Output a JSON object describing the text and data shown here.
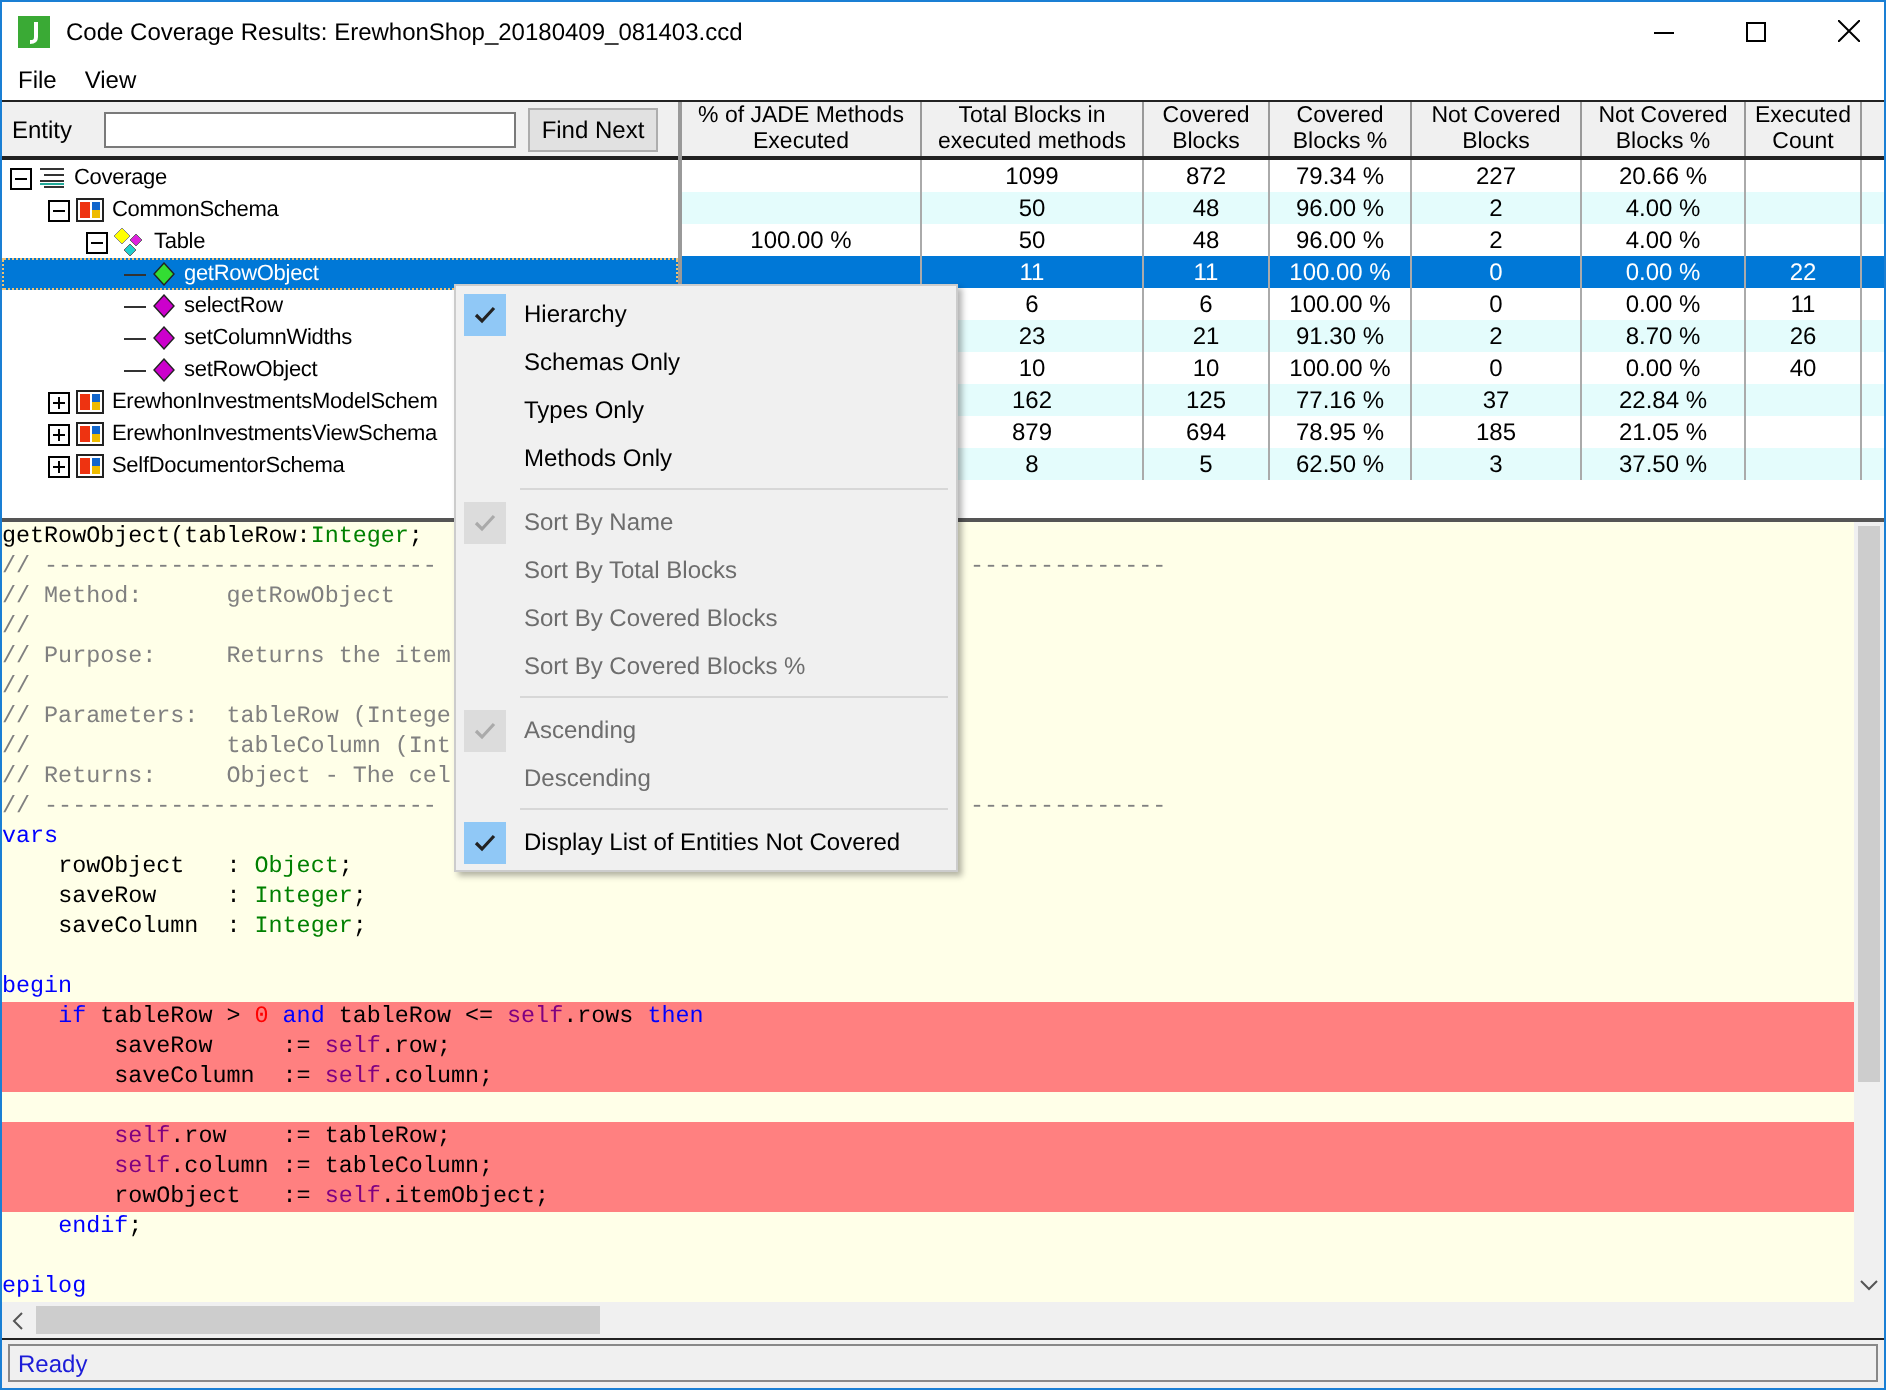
{
  "window": {
    "title": "Code Coverage Results: ErewhonShop_20180409_081403.ccd"
  },
  "menu_bar": [
    {
      "label": "File"
    },
    {
      "label": "View"
    }
  ],
  "entity_search": {
    "label": "Entity",
    "button": "Find Next"
  },
  "grid": {
    "columns": [
      "% of JADE Methods Executed",
      "Total Blocks in executed methods",
      "Covered Blocks",
      "Covered Blocks %",
      "Not Covered Blocks",
      "Not Covered Blocks %",
      "Executed Count"
    ]
  },
  "tree": [
    {
      "label": "Coverage",
      "kind": "root",
      "expanded": true,
      "selected": false,
      "cells": [
        null,
        "1099",
        "872",
        "79.34 %",
        "227",
        "20.66 %",
        null
      ],
      "children": [
        {
          "label": "CommonSchema",
          "kind": "schema",
          "expanded": true,
          "selected": false,
          "cells": [
            null,
            "50",
            "48",
            "96.00 %",
            "2",
            "4.00 %",
            null
          ],
          "children": [
            {
              "label": "Table",
              "kind": "type",
              "expanded": true,
              "selected": false,
              "cells": [
                "100.00 %",
                "50",
                "48",
                "96.00 %",
                "2",
                "4.00 %",
                null
              ],
              "children": [
                {
                  "label": "getRowObject",
                  "kind": "method",
                  "color": "#33dd33",
                  "selected": true,
                  "cells": [
                    null,
                    "11",
                    "11",
                    "100.00 %",
                    "0",
                    "0.00 %",
                    "22"
                  ]
                },
                {
                  "label": "selectRow",
                  "kind": "method",
                  "color": "#cc00cc",
                  "selected": false,
                  "cells": [
                    null,
                    "6",
                    "6",
                    "100.00 %",
                    "0",
                    "0.00 %",
                    "11"
                  ]
                },
                {
                  "label": "setColumnWidths",
                  "kind": "method",
                  "color": "#cc00cc",
                  "selected": false,
                  "cells": [
                    null,
                    "23",
                    "21",
                    "91.30 %",
                    "2",
                    "8.70 %",
                    "26"
                  ]
                },
                {
                  "label": "setRowObject",
                  "kind": "method",
                  "color": "#cc00cc",
                  "selected": false,
                  "cells": [
                    null,
                    "10",
                    "10",
                    "100.00 %",
                    "0",
                    "0.00 %",
                    "40"
                  ]
                }
              ]
            }
          ]
        },
        {
          "label": "ErewhonInvestmentsModelSchem",
          "kind": "schema",
          "expanded": false,
          "selected": false,
          "cells": [
            null,
            "162",
            "125",
            "77.16 %",
            "37",
            "22.84 %",
            null
          ]
        },
        {
          "label": "ErewhonInvestmentsViewSchema",
          "kind": "schema",
          "expanded": false,
          "selected": false,
          "cells": [
            null,
            "879",
            "694",
            "78.95 %",
            "185",
            "21.05 %",
            null
          ]
        },
        {
          "label": "SelfDocumentorSchema",
          "kind": "schema",
          "expanded": false,
          "selected": false,
          "cells": [
            null,
            "8",
            "5",
            "62.50 %",
            "3",
            "37.50 %",
            null
          ]
        }
      ]
    }
  ],
  "code": [
    {
      "uncovered": false,
      "segments": [
        {
          "t": "getRowObject(tableRow:",
          "kind": "plain"
        },
        {
          "t": "Integer",
          "kind": "type"
        },
        {
          "t": ";",
          "kind": "plain"
        }
      ]
    },
    {
      "uncovered": false,
      "segments": [
        {
          "t": "// ----------------------------",
          "kind": "comment"
        },
        {
          "t": "                                      --------------",
          "kind": "comment"
        }
      ]
    },
    {
      "uncovered": false,
      "segments": [
        {
          "t": "// Method:      getRowObject",
          "kind": "comment"
        }
      ]
    },
    {
      "uncovered": false,
      "segments": [
        {
          "t": "//",
          "kind": "comment"
        }
      ]
    },
    {
      "uncovered": false,
      "segments": [
        {
          "t": "// Purpose:     Returns the item",
          "kind": "comment"
        }
      ]
    },
    {
      "uncovered": false,
      "segments": [
        {
          "t": "//",
          "kind": "comment"
        }
      ]
    },
    {
      "uncovered": false,
      "segments": [
        {
          "t": "// Parameters:  tableRow (Intege",
          "kind": "comment"
        }
      ]
    },
    {
      "uncovered": false,
      "segments": [
        {
          "t": "//              tableColumn (Int",
          "kind": "comment"
        }
      ]
    },
    {
      "uncovered": false,
      "segments": [
        {
          "t": "// Returns:     Object - The cel",
          "kind": "comment"
        }
      ]
    },
    {
      "uncovered": false,
      "segments": [
        {
          "t": "// ----------------------------",
          "kind": "comment"
        },
        {
          "t": "                                      --------------",
          "kind": "comment"
        }
      ]
    },
    {
      "uncovered": false,
      "segments": [
        {
          "t": "vars",
          "kind": "keyword"
        }
      ]
    },
    {
      "uncovered": false,
      "segments": [
        {
          "t": "    rowObject   : ",
          "kind": "plain"
        },
        {
          "t": "Object",
          "kind": "type"
        },
        {
          "t": ";",
          "kind": "plain"
        }
      ]
    },
    {
      "uncovered": false,
      "segments": [
        {
          "t": "    saveRow     : ",
          "kind": "plain"
        },
        {
          "t": "Integer",
          "kind": "type"
        },
        {
          "t": ";",
          "kind": "plain"
        }
      ]
    },
    {
      "uncovered": false,
      "segments": [
        {
          "t": "    saveColumn  : ",
          "kind": "plain"
        },
        {
          "t": "Integer",
          "kind": "type"
        },
        {
          "t": ";",
          "kind": "plain"
        }
      ]
    },
    {
      "uncovered": false
    },
    {
      "uncovered": false,
      "segments": [
        {
          "t": "begin",
          "kind": "keyword"
        }
      ]
    },
    {
      "uncovered": true,
      "segments": [
        {
          "t": "    if",
          "kind": "keyword"
        },
        {
          "t": " tableRow > ",
          "kind": "plain"
        },
        {
          "t": "0",
          "kind": "number"
        },
        {
          "t": " and",
          "kind": "keyword"
        },
        {
          "t": " tableRow <= ",
          "kind": "plain"
        },
        {
          "t": "self",
          "kind": "self"
        },
        {
          "t": ".rows ",
          "kind": "plain"
        },
        {
          "t": "then",
          "kind": "keyword"
        }
      ]
    },
    {
      "uncovered": true,
      "segments": [
        {
          "t": "        saveRow     := ",
          "kind": "plain"
        },
        {
          "t": "self",
          "kind": "self"
        },
        {
          "t": ".row;",
          "kind": "plain"
        }
      ]
    },
    {
      "uncovered": true,
      "segments": [
        {
          "t": "        saveColumn  := ",
          "kind": "plain"
        },
        {
          "t": "self",
          "kind": "self"
        },
        {
          "t": ".column;",
          "kind": "plain"
        }
      ]
    },
    {
      "uncovered": false
    },
    {
      "uncovered": true,
      "segments": [
        {
          "t": "        self",
          "kind": "self"
        },
        {
          "t": ".row    := tableRow;",
          "kind": "plain"
        }
      ]
    },
    {
      "uncovered": true,
      "segments": [
        {
          "t": "        self",
          "kind": "self"
        },
        {
          "t": ".column := tableColumn;",
          "kind": "plain"
        }
      ]
    },
    {
      "uncovered": true,
      "segments": [
        {
          "t": "        rowObject   := ",
          "kind": "plain"
        },
        {
          "t": "self",
          "kind": "self"
        },
        {
          "t": ".itemObject;",
          "kind": "plain"
        }
      ]
    },
    {
      "uncovered": false,
      "segments": [
        {
          "t": "    endif",
          "kind": "keyword"
        },
        {
          "t": ";",
          "kind": "plain"
        }
      ]
    },
    {
      "uncovered": false
    },
    {
      "uncovered": false,
      "segments": [
        {
          "t": "epilog",
          "kind": "keyword"
        }
      ]
    }
  ],
  "context_menu": [
    {
      "kind": "item",
      "label": "Hierarchy",
      "checked": true,
      "disabled": false
    },
    {
      "kind": "item",
      "label": "Schemas Only",
      "checked": false,
      "disabled": false
    },
    {
      "kind": "item",
      "label": "Types Only",
      "checked": false,
      "disabled": false
    },
    {
      "kind": "item",
      "label": "Methods Only",
      "checked": false,
      "disabled": false
    },
    {
      "kind": "separator"
    },
    {
      "kind": "item",
      "label": "Sort By Name",
      "checked": true,
      "disabled": true
    },
    {
      "kind": "item",
      "label": "Sort By Total Blocks",
      "checked": false,
      "disabled": true
    },
    {
      "kind": "item",
      "label": "Sort By Covered Blocks",
      "checked": false,
      "disabled": true
    },
    {
      "kind": "item",
      "label": "Sort By Covered Blocks %",
      "checked": false,
      "disabled": true
    },
    {
      "kind": "separator"
    },
    {
      "kind": "item",
      "label": "Ascending",
      "checked": true,
      "disabled": true
    },
    {
      "kind": "item",
      "label": "Descending",
      "checked": false,
      "disabled": true
    },
    {
      "kind": "separator"
    },
    {
      "kind": "item",
      "label": "Display List of Entities Not Covered",
      "checked": true,
      "disabled": false
    }
  ],
  "status_bar": {
    "text": "Ready"
  }
}
